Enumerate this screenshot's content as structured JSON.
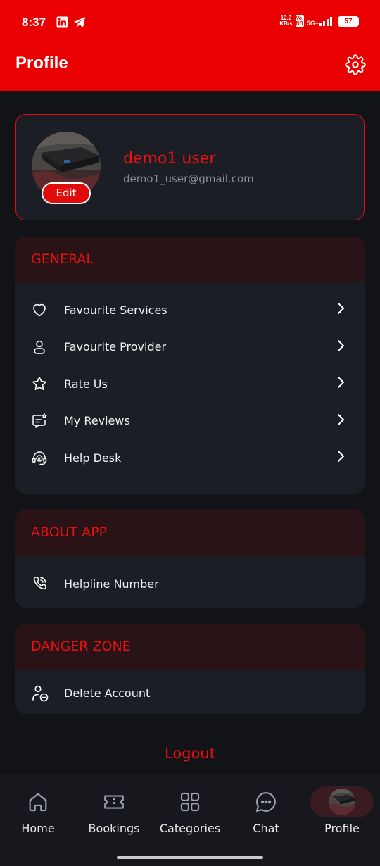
{
  "status_bar": {
    "time": "8:37",
    "net_speed_value": "12.2",
    "net_speed_unit": "KB/s",
    "network": "5G+",
    "battery": "57"
  },
  "app_bar": {
    "title": "Profile",
    "settings_icon": "gear-icon"
  },
  "profile": {
    "name": "demo1 user",
    "email": "demo1_user@gmail.com",
    "edit_label": "Edit"
  },
  "sections": {
    "general": {
      "title": "GENERAL",
      "items": [
        {
          "label": "Favourite Services",
          "icon": "heart-icon"
        },
        {
          "label": "Favourite Provider",
          "icon": "user-icon"
        },
        {
          "label": "Rate Us",
          "icon": "star-icon"
        },
        {
          "label": "My Reviews",
          "icon": "review-icon"
        },
        {
          "label": "Help Desk",
          "icon": "headset-icon"
        }
      ]
    },
    "about": {
      "title": "ABOUT APP",
      "items": [
        {
          "label": "Helpline Number",
          "icon": "phone-icon"
        }
      ]
    },
    "danger": {
      "title": "DANGER ZONE",
      "items": [
        {
          "label": "Delete Account",
          "icon": "delete-user-icon"
        }
      ]
    }
  },
  "logout_label": "Logout",
  "bottom_nav": {
    "items": [
      {
        "label": "Home",
        "icon": "home-icon"
      },
      {
        "label": "Bookings",
        "icon": "ticket-icon"
      },
      {
        "label": "Categories",
        "icon": "grid-icon"
      },
      {
        "label": "Chat",
        "icon": "chat-icon"
      },
      {
        "label": "Profile",
        "icon": "avatar"
      }
    ],
    "active": "Profile"
  },
  "colors": {
    "accent": "#ea0000",
    "background": "#121317",
    "card": "#1c1e25",
    "section_header": "#2a1317"
  }
}
